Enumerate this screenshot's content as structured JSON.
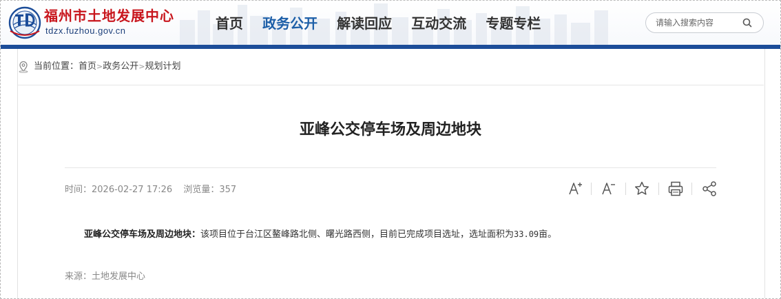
{
  "header": {
    "site_name": "福州市土地发展中心",
    "site_domain": "tdzx.fuzhou.gov.cn",
    "logo_icon": "fuzhou-land-center-emblem"
  },
  "nav": {
    "items": [
      {
        "label": "首页",
        "active": false
      },
      {
        "label": "政务公开",
        "active": true
      },
      {
        "label": "解读回应",
        "active": false
      },
      {
        "label": "互动交流",
        "active": false
      },
      {
        "label": "专题专栏",
        "active": false
      }
    ]
  },
  "search": {
    "placeholder": "请输入搜索内容",
    "icon": "search-icon"
  },
  "breadcrumb": {
    "icon": "location-icon",
    "prefix": "当前位置：",
    "items": [
      "首页",
      "政务公开",
      "规划计划"
    ],
    "separator": ">"
  },
  "article": {
    "title": "亚峰公交停车场及周边地块",
    "time_label": "时间：",
    "time": "2026-02-27 17:26",
    "views_label": "浏览量：",
    "views": "357",
    "body_lead": "亚峰公交停车场及周边地块：",
    "body_text": "该项目位于台江区鳌峰路北侧、曙光路西侧，目前已完成项目选址，选址面积为",
    "body_area": "33.09",
    "body_unit": "亩。",
    "source_label": "来源：",
    "source": "土地发展中心"
  },
  "tools": [
    "font-increase-icon",
    "font-decrease-icon",
    "favorite-star-icon",
    "print-icon",
    "share-icon"
  ],
  "colors": {
    "brand_red": "#c8161d",
    "brand_blue": "#1c4d99",
    "nav_active": "#1d5fa8",
    "nav_text": "#333333",
    "meta_text": "#888888"
  }
}
